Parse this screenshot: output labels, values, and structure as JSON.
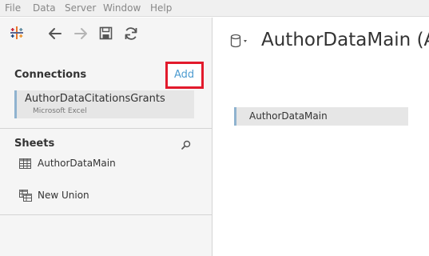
{
  "menu": [
    "File",
    "Data",
    "Server",
    "Window",
    "Help"
  ],
  "toolbar": {
    "icons": [
      "tableau-logo-icon",
      "back-arrow-icon",
      "forward-arrow-icon",
      "save-icon",
      "refresh-icon"
    ]
  },
  "connections": {
    "title": "Connections",
    "add_label": "Add",
    "items": [
      {
        "name": "AuthorDataCitationsGrants",
        "type": "Microsoft Excel"
      }
    ]
  },
  "sheets": {
    "title": "Sheets",
    "items": [
      {
        "label": "AuthorDataMain",
        "icon": "table-grid-icon"
      },
      {
        "label": "New Union",
        "icon": "union-icon"
      }
    ]
  },
  "canvas": {
    "datasource_title": "AuthorDataMain (A",
    "table_label": "AuthorDataMain"
  },
  "colors": {
    "highlight_border": "#e21a2c",
    "link": "#4e9cd0",
    "selection_bar": "#8fb3cf"
  }
}
